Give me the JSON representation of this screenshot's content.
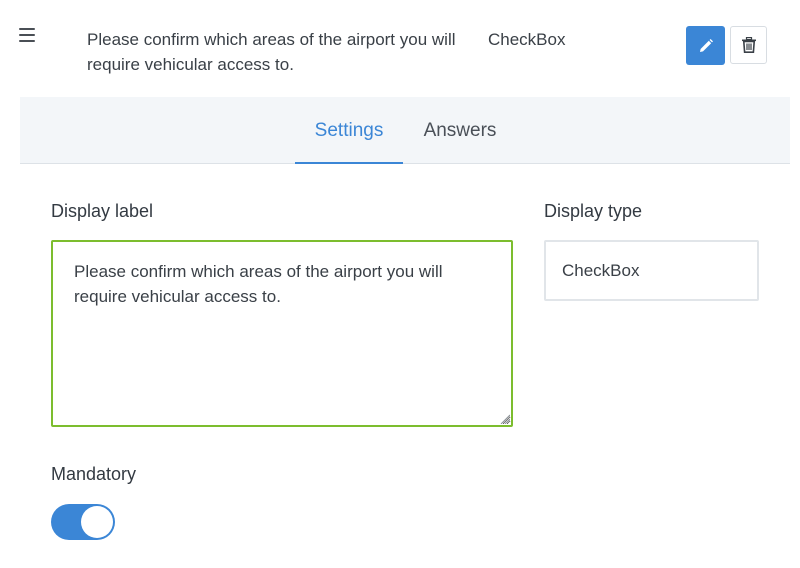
{
  "question": {
    "text": "Please confirm which areas of the airport you will require vehicular access to.",
    "type": "CheckBox"
  },
  "actions": {
    "edit_icon": "pencil-icon",
    "delete_icon": "trash-icon",
    "accent_color": "#3b86d6"
  },
  "tabs": [
    {
      "label": "Settings",
      "active": true
    },
    {
      "label": "Answers",
      "active": false
    }
  ],
  "form": {
    "display_label": {
      "label": "Display label",
      "value": "Please confirm which areas of the airport you will require vehicular access to.",
      "border_color": "#7cbd2e"
    },
    "display_type": {
      "label": "Display type",
      "value": "CheckBox"
    },
    "mandatory": {
      "label": "Mandatory",
      "on": true
    }
  }
}
